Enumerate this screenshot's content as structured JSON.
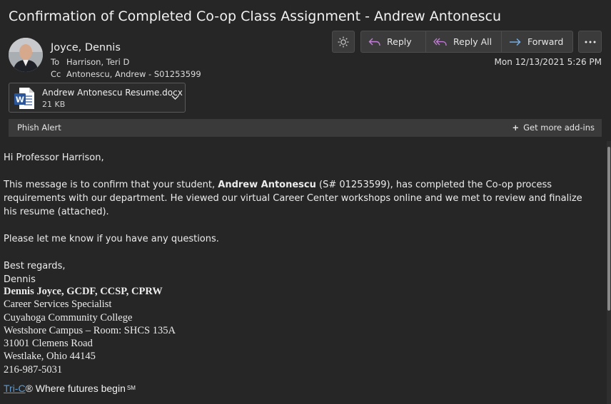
{
  "subject": "Confirmation of Completed Co-op Class Assignment - Andrew Antonescu",
  "sender": {
    "name": "Joyce, Dennis"
  },
  "recipients": {
    "to_label": "To",
    "to": "Harrison, Teri D",
    "cc_label": "Cc",
    "cc": "Antonescu, Andrew - S01253599"
  },
  "toolbar": {
    "reply": "Reply",
    "reply_all": "Reply All",
    "forward": "Forward"
  },
  "date": "Mon 12/13/2021 5:26 PM",
  "attachment": {
    "name": "Andrew Antonescu Resume.docx",
    "size": "21 KB"
  },
  "addin_bar": {
    "phish": "Phish Alert",
    "more": "Get more add-ins"
  },
  "body": {
    "greeting": "Hi Professor Harrison,",
    "p1_pre": "This message is to confirm that your student, ",
    "p1_bold": "Andrew Antonescu",
    "p1_post": " (S# 01253599), has completed the Co-op process requirements with our department. He viewed our virtual Career Center workshops online and we met to review and finalize his resume (attached).",
    "p2": "Please let me know if you have any questions.",
    "closing": "Best regards,",
    "closing_name": "Dennis"
  },
  "signature": {
    "name": "Dennis Joyce, GCDF, CCSP, CPRW",
    "title": "Career Services Specialist",
    "org": "Cuyahoga Community College",
    "campus": "Westshore Campus – Room: SHCS 135A",
    "street": "31001 Clemens Road",
    "city": "Westlake, Ohio 44145",
    "phone": "216-987-5031"
  },
  "tagline": {
    "link": "Tri-C",
    "text": "® Where futures begin",
    "mark": "SM"
  },
  "colors": {
    "background": "#262626",
    "link": "#5b9bd5",
    "reply_icon": "#c47fd8",
    "forward_icon": "#7ab3e8",
    "word_icon": "#2b579a"
  }
}
